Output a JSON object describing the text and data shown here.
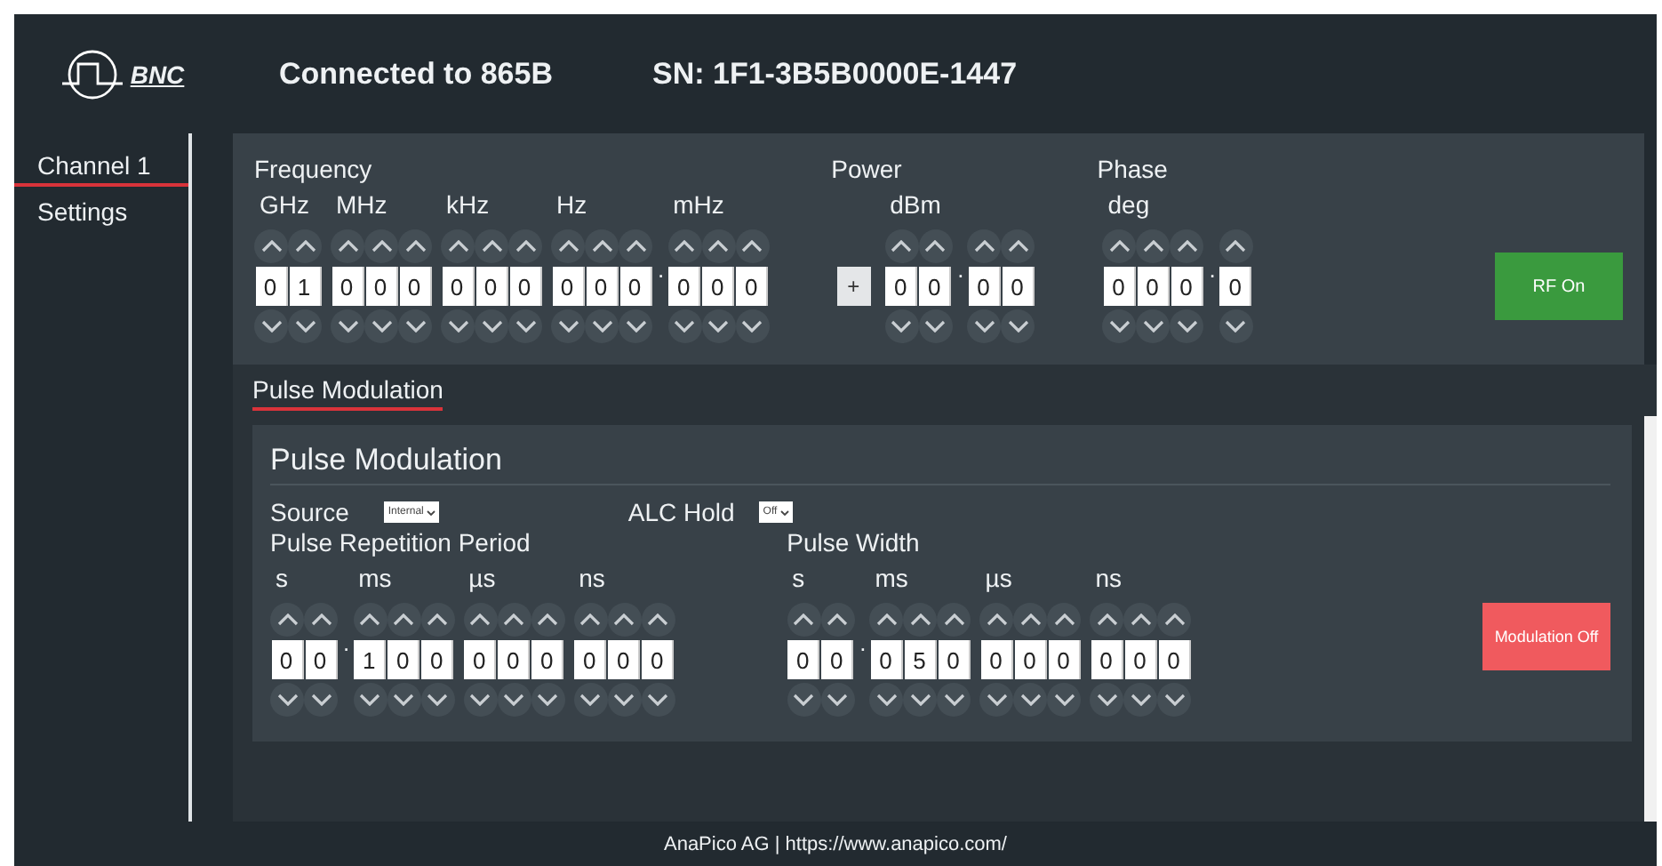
{
  "header": {
    "logo": "BNC",
    "connection": "Connected to 865B",
    "serial": "SN: 1F1-3B5B0000E-1447"
  },
  "sidebar": {
    "items": [
      {
        "label": "Channel 1",
        "selected": true
      },
      {
        "label": "Settings",
        "selected": false
      }
    ]
  },
  "frequency": {
    "label": "Frequency",
    "groups": [
      {
        "unit": "GHz",
        "digits": [
          "0",
          "1"
        ]
      },
      {
        "unit": "MHz",
        "digits": [
          "0",
          "0",
          "0"
        ]
      },
      {
        "unit": "kHz",
        "digits": [
          "0",
          "0",
          "0"
        ]
      },
      {
        "unit": "Hz",
        "digits": [
          "0",
          "0",
          "0"
        ]
      },
      {
        "unit": "mHz",
        "separator": ".",
        "digits": [
          "0",
          "0",
          "0"
        ]
      }
    ]
  },
  "power": {
    "label": "Power",
    "sign": "+",
    "groups": [
      {
        "unit": "dBm",
        "digits": [
          "0",
          "0"
        ]
      },
      {
        "separator": ".",
        "digits": [
          "0",
          "0"
        ]
      }
    ]
  },
  "phase": {
    "label": "Phase",
    "groups": [
      {
        "unit": "deg",
        "digits": [
          "0",
          "0",
          "0"
        ]
      },
      {
        "separator": ".",
        "digits": [
          "0"
        ]
      }
    ]
  },
  "rf_button": {
    "label": "RF On",
    "on": true
  },
  "tabs": [
    {
      "label": "Pulse Modulation",
      "selected": true
    }
  ],
  "pulse": {
    "title": "Pulse Modulation",
    "source": {
      "label": "Source",
      "value": "Internal"
    },
    "alc_hold": {
      "label": "ALC Hold",
      "value": "Off"
    },
    "period": {
      "label": "Pulse Repetition Period",
      "groups": [
        {
          "unit": "s",
          "digits": [
            "0",
            "0"
          ]
        },
        {
          "unit": "ms",
          "separator": ".",
          "digits": [
            "1",
            "0",
            "0"
          ]
        },
        {
          "unit": "µs",
          "digits": [
            "0",
            "0",
            "0"
          ]
        },
        {
          "unit": "ns",
          "digits": [
            "0",
            "0",
            "0"
          ]
        }
      ]
    },
    "width": {
      "label": "Pulse Width",
      "groups": [
        {
          "unit": "s",
          "digits": [
            "0",
            "0"
          ]
        },
        {
          "unit": "ms",
          "separator": ".",
          "digits": [
            "0",
            "5",
            "0"
          ]
        },
        {
          "unit": "µs",
          "digits": [
            "0",
            "0",
            "0"
          ]
        },
        {
          "unit": "ns",
          "digits": [
            "0",
            "0",
            "0"
          ]
        }
      ]
    },
    "modulation_button": {
      "label": "Modulation Off",
      "on": false
    }
  },
  "footer": "AnaPico AG | https://www.anapico.com/"
}
